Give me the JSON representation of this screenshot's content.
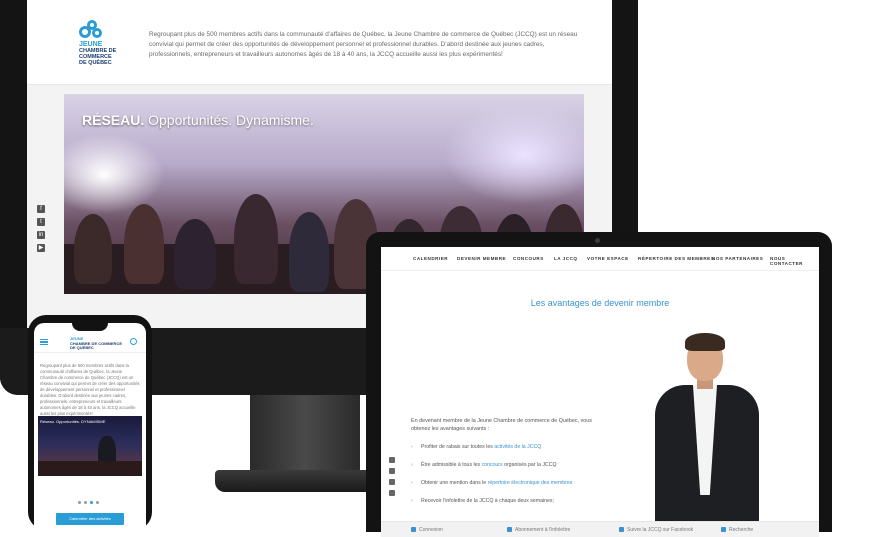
{
  "desktop": {
    "logo": {
      "line1": "JEUNE",
      "line2": "CHAMBRE DE COMMERCE",
      "line3": "DE QUÉBEC"
    },
    "intro": "Regroupant plus de 500 membres actifs dans la communauté d’affaires de Québec, la Jeune Chambre de commerce de Québec (JCCQ) est un réseau convivial qui permet de créer des opportunités de développement personnel et professionnel durables. D’abord destinée aux jeunes cadres, professionnels, entrepreneurs et travailleurs autonomes âgés de 18 à 40 ans, la JCCQ accueille aussi les plus expérimentés!",
    "hero": {
      "bold": "RÉSEAU.",
      "rest": " Opportunités. Dynamisme."
    },
    "social_icons": [
      "facebook-icon",
      "twitter-icon",
      "linkedin-icon",
      "youtube-icon"
    ]
  },
  "laptop": {
    "nav": [
      "CALENDRIER",
      "DEVENIR MEMBRE",
      "CONCOURS",
      "LA JCCQ",
      "VOTRE ESPACE",
      "RÉPERTOIRE DES MEMBRES",
      "NOS PARTENAIRES",
      "NOUS CONTACTER"
    ],
    "title": "Les avantages de devenir membre",
    "intro": "En devenant membre de la Jeune Chambre de commerce de Québec, vous obtenez les avantages suivants :",
    "benefits": [
      {
        "before": "Profiter de rabais sur toutes les ",
        "link": "activités de la JCCQ",
        "after": ""
      },
      {
        "before": "Être admissible à tous les ",
        "link": "concours",
        "after": " organisés par la JCCQ"
      },
      {
        "before": "Obtenir une mention dans le ",
        "link": "répertoire électronique des membres",
        "after": ""
      },
      {
        "before": "Recevoir l’infolettre de la JCCQ à chaque deux semaines;",
        "link": "",
        "after": ""
      }
    ],
    "footer": [
      "Connexion",
      "Abonnement à l’infolettre",
      "Suivre la JCCQ sur Facebook",
      "Recherche"
    ]
  },
  "phone": {
    "logo": {
      "line1": "JEUNE",
      "line2": "CHAMBRE DE COMMERCE",
      "line3": "DE QUÉBEC"
    },
    "intro": "Regroupant plus de 500 membres actifs dans la communauté d’affaires de Québec, la Jeune Chambre de commerce de Québec (JCCQ) est un réseau convivial qui permet de créer des opportunités de développement personnel et professionnel durables. D’abord destinée aux jeunes cadres, professionnels, entrepreneurs et travailleurs autonomes âgés de 18 à 40 ans, la JCCQ accueille aussi les plus expérimentés!",
    "hero_caption": "Réseau. Opportunités. DYNAMISME",
    "button": "Calendrier des activités"
  },
  "colors": {
    "accent": "#2a9dd6",
    "navy": "#1c3f6e"
  }
}
